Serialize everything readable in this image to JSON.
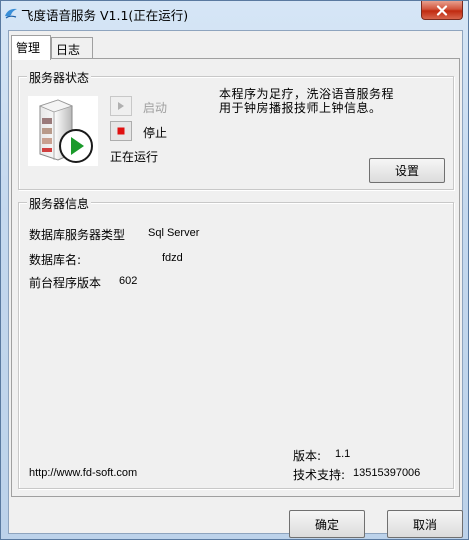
{
  "window": {
    "title": "飞度语音服务 V1.1(正在运行)"
  },
  "tabs": [
    {
      "label": "管理"
    },
    {
      "label": "日志"
    }
  ],
  "server_status": {
    "group_label": "服务器状态",
    "start_label": "启动",
    "stop_label": "停止",
    "running_text": "正在运行",
    "description_line1": "本程序为足疗，洗浴语音服务程",
    "description_line2": "用于钟房播报技师上钟信息。",
    "settings_label": "设置"
  },
  "server_info": {
    "group_label": "服务器信息",
    "db_type_label": "数据库服务器类型",
    "db_type_value": "Sql Server",
    "db_name_label": "数据库名:",
    "db_name_value": "fdzd",
    "frontend_label": "前台程序版本",
    "frontend_value": "602",
    "website": "http://www.fd-soft.com",
    "version_label": "版本:",
    "version_value": "1.1",
    "support_label": "技术支持:",
    "support_value": "13515397006"
  },
  "footer": {
    "ok_label": "确定",
    "cancel_label": "取消"
  }
}
